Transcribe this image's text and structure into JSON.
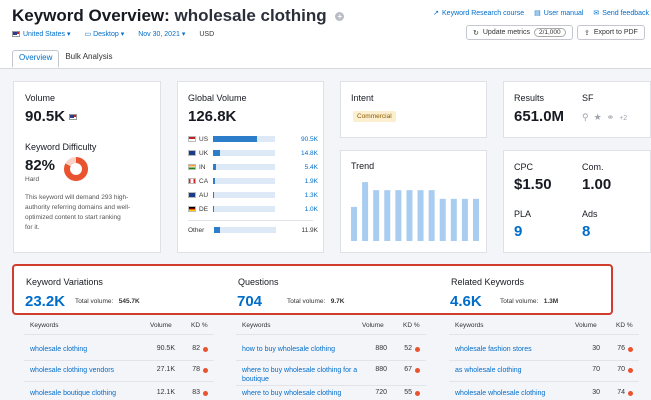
{
  "header": {
    "title_prefix": "Keyword Overview:",
    "keyword": "wholesale clothing",
    "links": [
      "Keyword Research course",
      "User manual",
      "Send feedback"
    ],
    "filters": {
      "country": "United States",
      "device": "Desktop",
      "date": "Nov 30, 2021",
      "currency": "USD"
    },
    "update_button": "Update metrics",
    "update_count": "2/1,000",
    "export_button": "Export to PDF",
    "tabs": [
      "Overview",
      "Bulk Analysis"
    ]
  },
  "volume": {
    "label": "Volume",
    "value": "90.5K",
    "kd_label": "Keyword Difficulty",
    "kd_value": "82%",
    "kd_level": "Hard",
    "kd_percent": 82,
    "kd_desc_lines": [
      "This keyword will demand 293 high-",
      "authority referring domains and well-",
      "optimized content to start ranking",
      "for it."
    ]
  },
  "global": {
    "label": "Global Volume",
    "value": "126.8K",
    "rows": [
      {
        "code": "US",
        "val": "90.5K",
        "share": 0.71
      },
      {
        "code": "UK",
        "val": "14.8K",
        "share": 0.12
      },
      {
        "code": "IN",
        "val": "5.4K",
        "share": 0.05
      },
      {
        "code": "CA",
        "val": "1.9K",
        "share": 0.03
      },
      {
        "code": "AU",
        "val": "1.3K",
        "share": 0.02
      },
      {
        "code": "DE",
        "val": "1.0K",
        "share": 0.02
      }
    ],
    "other_label": "Other",
    "other_val": "11.9K",
    "other_share": 0.1
  },
  "intent": {
    "label": "Intent",
    "value": "Commercial"
  },
  "trend": {
    "label": "Trend",
    "values": [
      0.55,
      0.95,
      0.82,
      0.82,
      0.82,
      0.82,
      0.82,
      0.82,
      0.68,
      0.68,
      0.68,
      0.68
    ]
  },
  "results": {
    "label": "Results",
    "value": "651.0M",
    "sf_label": "SF",
    "sf_more": "+2"
  },
  "cpc": {
    "cpc_label": "CPC",
    "cpc_value": "$1.50",
    "com_label": "Com.",
    "com_value": "1.00",
    "pla_label": "PLA",
    "pla_value": "9",
    "ads_label": "Ads",
    "ads_value": "8"
  },
  "groups": [
    {
      "title": "Keyword Variations",
      "count": "23.2K",
      "tv_label": "Total volume:",
      "tv": "545.7K",
      "rows": [
        [
          "wholesale clothing",
          "90.5K",
          "82"
        ],
        [
          "wholesale clothing vendors",
          "27.1K",
          "78"
        ],
        [
          "wholesale boutique clothing",
          "12.1K",
          "83"
        ]
      ]
    },
    {
      "title": "Questions",
      "count": "704",
      "tv_label": "Total volume:",
      "tv": "9.7K",
      "rows": [
        [
          "how to buy wholesale clothing",
          "880",
          "52"
        ],
        [
          "where to buy wholesale clothing for a boutique",
          "880",
          "67"
        ],
        [
          "where to buy wholesale clothing",
          "720",
          "55"
        ]
      ]
    },
    {
      "title": "Related Keywords",
      "count": "4.6K",
      "tv_label": "Total volume:",
      "tv": "1.3M",
      "rows": [
        [
          "wholesale fashion stores",
          "30",
          "76"
        ],
        [
          "as wholesale clothing",
          "70",
          "70"
        ],
        [
          "wholesale wholesale clothing",
          "30",
          "74"
        ]
      ]
    }
  ],
  "table_headers": {
    "keywords": "Keywords",
    "volume": "Volume",
    "kd": "KD %"
  }
}
